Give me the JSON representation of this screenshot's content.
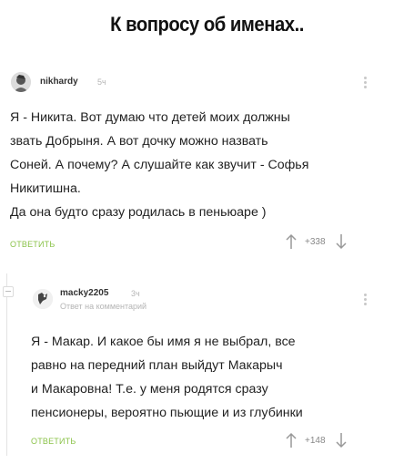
{
  "title": "К вопросу об именах..",
  "comments": [
    {
      "username": "nikhardy",
      "time": "5ч",
      "lines": [
        "Я - Никита. Вот думаю что детей моих должны",
        "звать Добрыня. А вот дочку можно назвать",
        "Соней. А почему? А слушайте как звучит - Софья",
        "Никитишна.",
        "Да она будто сразу родилась в пеньюаре )"
      ],
      "reply_label": "ОТВЕТИТЬ",
      "score": "+338"
    },
    {
      "username": "macky2205",
      "time": "3ч",
      "reply_note": "Ответ на комментарий",
      "lines": [
        "Я - Макар. И какое бы имя я не выбрал, все",
        "равно на передний план выйдут Макарыч",
        "и Макаровна! Т.е. у меня родятся сразу",
        "пенсионеры, вероятно пьющие и из глубинки"
      ],
      "reply_label": "ОТВЕТИТЬ",
      "score": "+148"
    }
  ],
  "colors": {
    "reply": "#8bc34a",
    "muted": "#b5b5b5",
    "text": "#222222"
  }
}
